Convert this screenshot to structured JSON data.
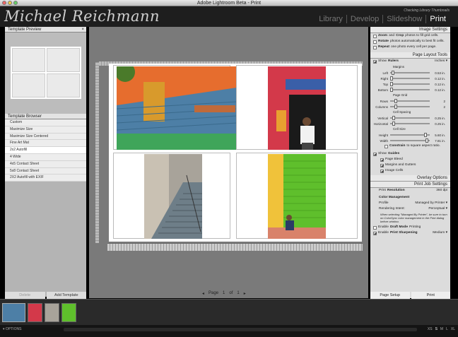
{
  "window": {
    "title": "Adobe Lightroom Beta - Print"
  },
  "header": {
    "brand": "Michael Reichmann",
    "status": "Checking Library Thumbnails",
    "modules": [
      "Library",
      "Develop",
      "Slideshow",
      "Print"
    ],
    "active_module": "Print"
  },
  "left_panel": {
    "preview_title": "Template Preview",
    "browser_title": "Template Browser",
    "templates": [
      "Custom",
      "Maximize Size",
      "Maximize Size Centered",
      "Fine Art Mat",
      "2x2 Autofill",
      "4 Wide",
      "4x5 Contact Sheet",
      "5x8 Contact Sheet",
      "2X2 Autofill with EXIF"
    ],
    "selected_template": "2x2 Autofill",
    "delete_label": "Delete",
    "add_label": "Add Template"
  },
  "page_nav": {
    "label": "Page",
    "current": "1",
    "of": "of",
    "total": "1"
  },
  "right_panel": {
    "image_settings": {
      "title": "Image Settings",
      "zoom_bold": "Zoom",
      "zoom_and": " and ",
      "zoom_bold2": "Crop",
      "zoom_text": " photos to fill grid cells.",
      "rotate_bold": "Rotate",
      "rotate_text": " photos automatically to best fit cells.",
      "repeat_bold": "Repeat",
      "repeat_text": " one photo every cell per page."
    },
    "layout_tools": {
      "title": "Page Layout Tools",
      "show_rulers": "Show ",
      "show_rulers_bold": "Rulers",
      "units": "Inches",
      "margins_label": "Margins",
      "margins": [
        {
          "label": "Left",
          "value": "0.53 in."
        },
        {
          "label": "Right",
          "value": "0.12 in."
        },
        {
          "label": "Top",
          "value": "0.12 in."
        },
        {
          "label": "Bottom",
          "value": "0.12 in."
        }
      ],
      "page_grid_label": "Page Grid",
      "grid": [
        {
          "label": "Rows",
          "value": "2"
        },
        {
          "label": "Columns",
          "value": "2"
        }
      ],
      "cell_spacing_label": "Cell Spacing",
      "spacing": [
        {
          "label": "Vertical",
          "value": "0.25 in."
        },
        {
          "label": "Horizontal",
          "value": "0.25 in."
        }
      ],
      "cell_size_label": "Cell Size",
      "size": [
        {
          "label": "Height",
          "value": "5.60 in."
        },
        {
          "label": "Width",
          "value": "7.81 in."
        }
      ],
      "constrain_bold": "Constrain",
      "constrain_text": " to square aspect ratio.",
      "show_guides": "Show ",
      "show_guides_bold": "Guides",
      "guides": [
        "Page Bleed",
        "Margins and Gutters",
        "Image Cells"
      ]
    },
    "overlay_title": "Overlay Options",
    "print_job": {
      "title": "Print Job Settings",
      "resolution_label": "Print ",
      "resolution_bold": "Resolution",
      "resolution_value": "360",
      "resolution_unit": "dpi",
      "color_mgmt": "Color Management",
      "profile_label": "Profile",
      "profile_value": "Managed by Printer",
      "intent_label": "Rendering Intent:",
      "intent_value": "Perceptual",
      "note": "When selecting \"Managed By Printer\", be sure to turn on ColorSync color management in the Print dialog before printing.",
      "draft_pre": "Enable ",
      "draft_bold": "Draft Mode",
      "draft_post": " Printing",
      "sharpen_pre": "Enable ",
      "sharpen_bold": "Print Sharpening",
      "sharpen_value": "Medium"
    },
    "page_setup_label": "Page Setup",
    "print_label": "Print"
  },
  "bottombar": {
    "options": "OPTIONS",
    "sizes": [
      "XS",
      "S",
      "M",
      "L",
      "XL"
    ]
  }
}
